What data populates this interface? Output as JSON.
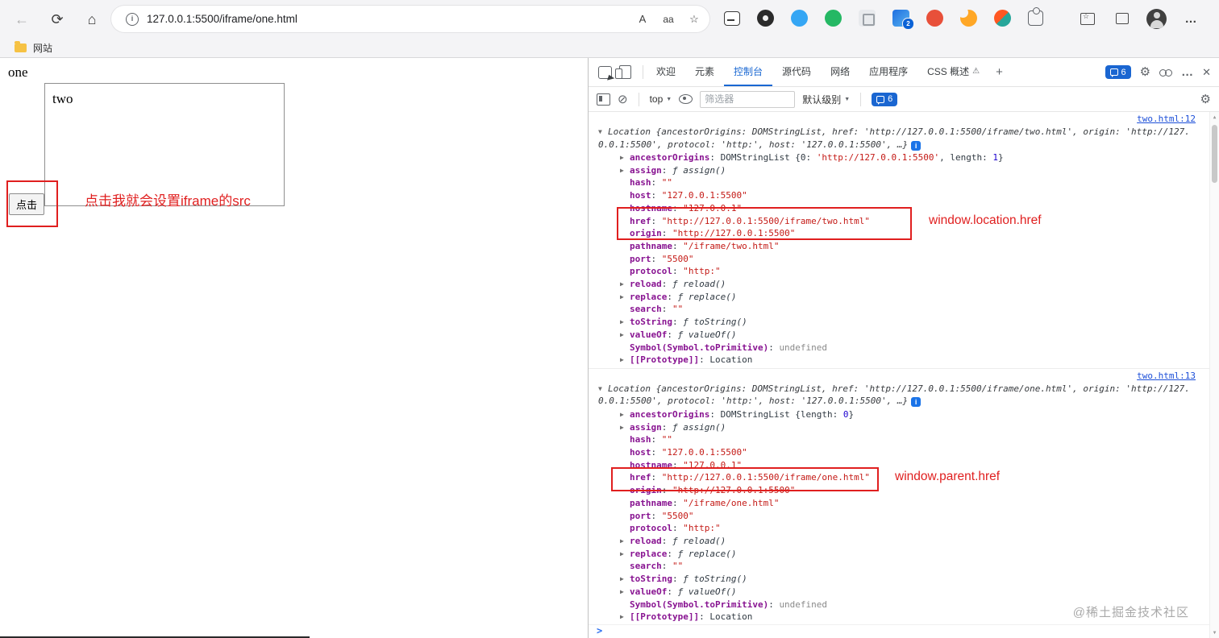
{
  "icons": {
    "back": "←",
    "refresh": "⟳",
    "home": "⌂",
    "read_aloud": "A",
    "text_size": "aa",
    "favorite": "☆",
    "more": "…",
    "close": "✕",
    "plus": "+",
    "gear": "⚙",
    "clear": "⊘",
    "caret": "▼",
    "tri_open": "▼",
    "tri_closed": "▶",
    "warn": "⚠",
    "info": "i",
    "scroll_up": "▲",
    "scroll_down": "▼"
  },
  "browser": {
    "url": "127.0.0.1:5500/iframe/one.html",
    "bookmark_label": "网站",
    "extension_badge": "2"
  },
  "page": {
    "heading": "one",
    "iframe_text": "two",
    "button_label": "点击",
    "annotation_text": "点击我就会设置iframe的src"
  },
  "devtools": {
    "tabs": [
      {
        "label": "欢迎",
        "active": false
      },
      {
        "label": "元素",
        "active": false
      },
      {
        "label": "控制台",
        "active": true
      },
      {
        "label": "源代码",
        "active": false
      },
      {
        "label": "网络",
        "active": false
      },
      {
        "label": "应用程序",
        "active": false
      },
      {
        "label": "CSS 概述",
        "active": false,
        "beta": true
      }
    ],
    "issues_badge": "6",
    "console_toolbar": {
      "context_label": "top",
      "filter_placeholder": "筛选器",
      "level_label": "默认级别",
      "issues_count": "6"
    },
    "prompt": ">",
    "watermark": "@稀土掘金技术社区",
    "annotations": [
      {
        "label": "window.location.href"
      },
      {
        "label": "window.parent.href"
      }
    ],
    "logs": [
      {
        "source": "two.html:12",
        "preview": "Location {ancestorOrigins: DOMStringList, href: 'http://127.0.0.1:5500/iframe/two.html', origin: 'http://127.0.0.1:5500', protocol: 'http:', host: '127.0.0.1:5500', …}",
        "properties": [
          {
            "exp": true,
            "key": "ancestorOrigins",
            "segs": [
              [
                "plain",
                "DOMStringList {0: "
              ],
              [
                "str",
                "'http://127.0.0.1:5500'"
              ],
              [
                "plain",
                ", length: "
              ],
              [
                "num",
                "1"
              ],
              [
                "plain",
                "}"
              ]
            ]
          },
          {
            "exp": true,
            "key": "assign",
            "segs": [
              [
                "fn",
                "ƒ assign()"
              ]
            ]
          },
          {
            "exp": false,
            "key": "hash",
            "segs": [
              [
                "str",
                "\"\""
              ]
            ]
          },
          {
            "exp": false,
            "key": "host",
            "segs": [
              [
                "str",
                "\"127.0.0.1:5500\""
              ]
            ]
          },
          {
            "exp": false,
            "key": "hostname",
            "segs": [
              [
                "str",
                "\"127.0.0.1\""
              ]
            ]
          },
          {
            "exp": false,
            "key": "href",
            "href": true,
            "segs": [
              [
                "str",
                "\"http://127.0.0.1:5500/iframe/two.html\""
              ]
            ]
          },
          {
            "exp": false,
            "key": "origin",
            "segs": [
              [
                "str",
                "\"http://127.0.0.1:5500\""
              ]
            ]
          },
          {
            "exp": false,
            "key": "pathname",
            "segs": [
              [
                "str",
                "\"/iframe/two.html\""
              ]
            ]
          },
          {
            "exp": false,
            "key": "port",
            "segs": [
              [
                "str",
                "\"5500\""
              ]
            ]
          },
          {
            "exp": false,
            "key": "protocol",
            "segs": [
              [
                "str",
                "\"http:\""
              ]
            ]
          },
          {
            "exp": true,
            "key": "reload",
            "segs": [
              [
                "fn",
                "ƒ reload()"
              ]
            ]
          },
          {
            "exp": true,
            "key": "replace",
            "segs": [
              [
                "fn",
                "ƒ replace()"
              ]
            ]
          },
          {
            "exp": false,
            "key": "search",
            "segs": [
              [
                "str",
                "\"\""
              ]
            ]
          },
          {
            "exp": true,
            "key": "toString",
            "segs": [
              [
                "fn",
                "ƒ toString()"
              ]
            ]
          },
          {
            "exp": true,
            "key": "valueOf",
            "segs": [
              [
                "fn",
                "ƒ valueOf()"
              ]
            ]
          },
          {
            "exp": false,
            "key": "Symbol(Symbol.toPrimitive)",
            "segs": [
              [
                "undef",
                "undefined"
              ]
            ]
          },
          {
            "exp": true,
            "key": "[[Prototype]]",
            "segs": [
              [
                "plain",
                "Location"
              ]
            ]
          }
        ]
      },
      {
        "source": "two.html:13",
        "preview": "Location {ancestorOrigins: DOMStringList, href: 'http://127.0.0.1:5500/iframe/one.html', origin: 'http://127.0.0.1:5500', protocol: 'http:', host: '127.0.0.1:5500', …}",
        "properties": [
          {
            "exp": true,
            "key": "ancestorOrigins",
            "segs": [
              [
                "plain",
                "DOMStringList {length: "
              ],
              [
                "num",
                "0"
              ],
              [
                "plain",
                "}"
              ]
            ]
          },
          {
            "exp": true,
            "key": "assign",
            "segs": [
              [
                "fn",
                "ƒ assign()"
              ]
            ]
          },
          {
            "exp": false,
            "key": "hash",
            "segs": [
              [
                "str",
                "\"\""
              ]
            ]
          },
          {
            "exp": false,
            "key": "host",
            "segs": [
              [
                "str",
                "\"127.0.0.1:5500\""
              ]
            ]
          },
          {
            "exp": false,
            "key": "hostname",
            "segs": [
              [
                "str",
                "\"127.0.0.1\""
              ]
            ]
          },
          {
            "exp": false,
            "key": "href",
            "href": true,
            "segs": [
              [
                "str",
                "\"http://127.0.0.1:5500/iframe/one.html\""
              ]
            ]
          },
          {
            "exp": false,
            "key": "origin",
            "segs": [
              [
                "str",
                "\"http://127.0.0.1:5500\""
              ]
            ]
          },
          {
            "exp": false,
            "key": "pathname",
            "segs": [
              [
                "str",
                "\"/iframe/one.html\""
              ]
            ]
          },
          {
            "exp": false,
            "key": "port",
            "segs": [
              [
                "str",
                "\"5500\""
              ]
            ]
          },
          {
            "exp": false,
            "key": "protocol",
            "segs": [
              [
                "str",
                "\"http:\""
              ]
            ]
          },
          {
            "exp": true,
            "key": "reload",
            "segs": [
              [
                "fn",
                "ƒ reload()"
              ]
            ]
          },
          {
            "exp": true,
            "key": "replace",
            "segs": [
              [
                "fn",
                "ƒ replace()"
              ]
            ]
          },
          {
            "exp": false,
            "key": "search",
            "segs": [
              [
                "str",
                "\"\""
              ]
            ]
          },
          {
            "exp": true,
            "key": "toString",
            "segs": [
              [
                "fn",
                "ƒ toString()"
              ]
            ]
          },
          {
            "exp": true,
            "key": "valueOf",
            "segs": [
              [
                "fn",
                "ƒ valueOf()"
              ]
            ]
          },
          {
            "exp": false,
            "key": "Symbol(Symbol.toPrimitive)",
            "segs": [
              [
                "undef",
                "undefined"
              ]
            ]
          },
          {
            "exp": true,
            "key": "[[Prototype]]",
            "segs": [
              [
                "plain",
                "Location"
              ]
            ]
          }
        ]
      }
    ]
  }
}
